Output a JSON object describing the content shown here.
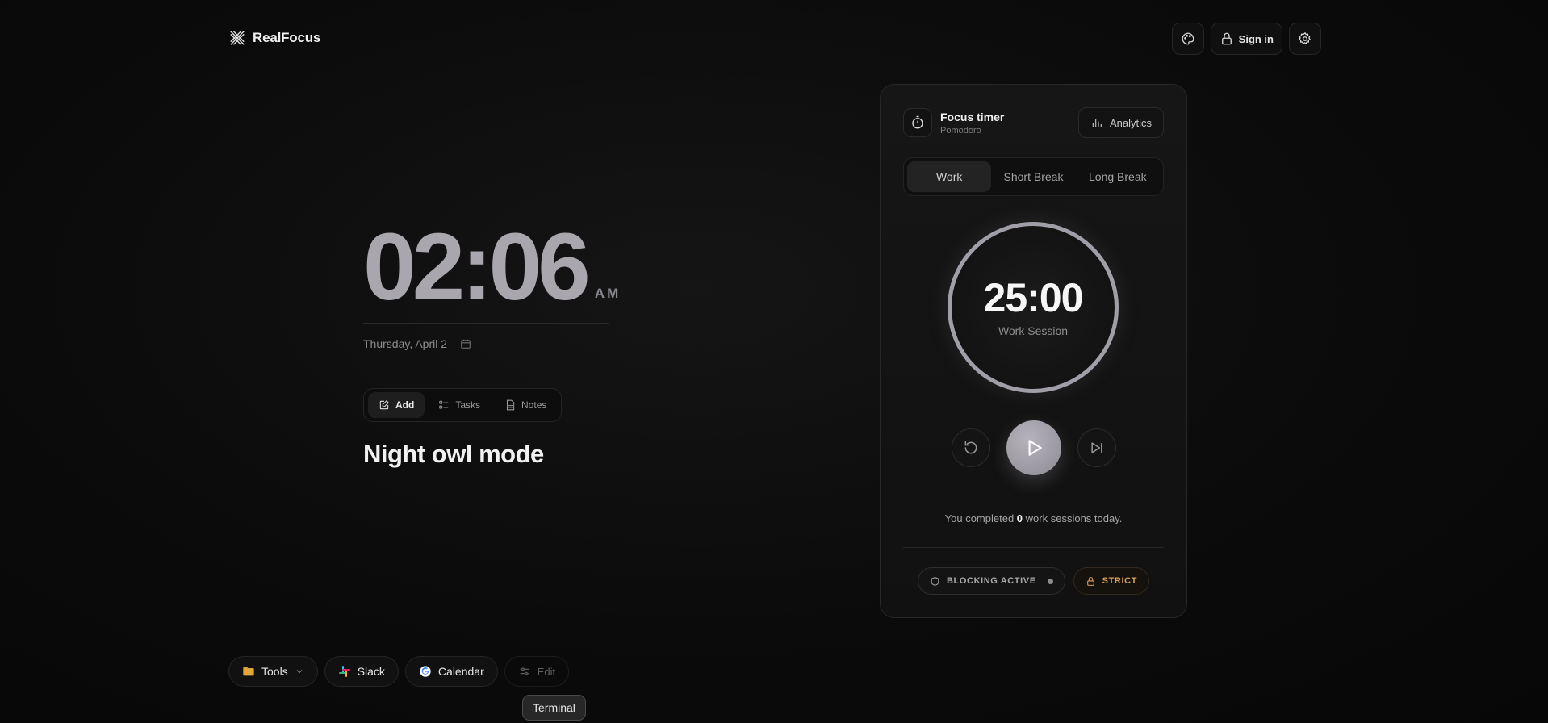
{
  "app": {
    "name": "RealFocus"
  },
  "header": {
    "sign_in_label": "Sign in"
  },
  "clock": {
    "time": "02:06",
    "period": "AM",
    "date": "Thursday, April 2"
  },
  "quick_tabs": {
    "add": "Add",
    "tasks": "Tasks",
    "notes": "Notes"
  },
  "headline": "Night owl mode",
  "timer_card": {
    "title": "Focus timer",
    "subtitle": "Pomodoro",
    "analytics_label": "Analytics",
    "modes": {
      "work": "Work",
      "short_break": "Short Break",
      "long_break": "Long Break"
    },
    "time": "25:00",
    "session_label": "Work Session",
    "completed_prefix": "You completed",
    "completed_count": "0",
    "completed_suffix": "work sessions today.",
    "blocking_label": "BLOCKING ACTIVE",
    "strict_label": "STRICT"
  },
  "dock": {
    "tools": "Tools",
    "slack": "Slack",
    "calendar": "Calendar",
    "edit": "Edit"
  },
  "tooltip": "Terminal",
  "colors": {
    "accent": "#a19ea8",
    "strict": "#d9a05b",
    "folder": "#e0a63a"
  }
}
